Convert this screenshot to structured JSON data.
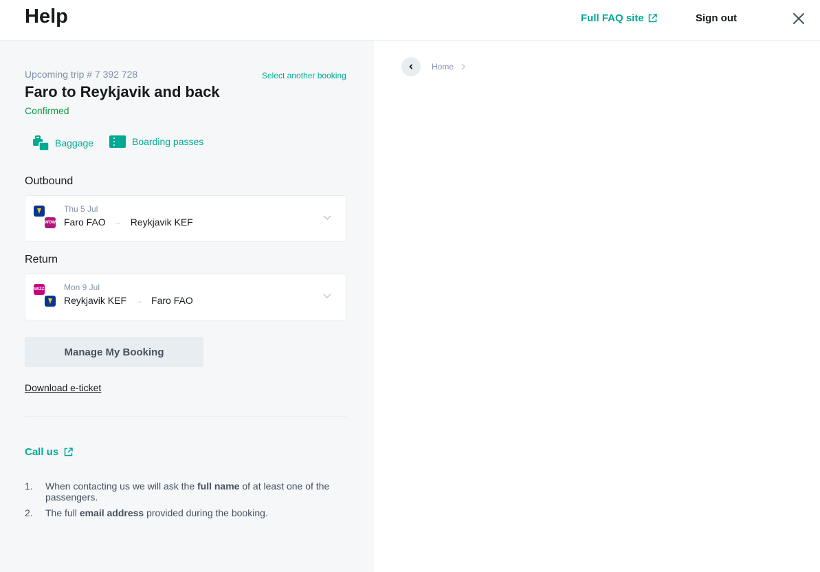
{
  "header": {
    "title": "Help",
    "faq_label": "Full FAQ site",
    "signout_label": "Sign out"
  },
  "booking": {
    "trip_label": "Upcoming trip # 7 392 728",
    "select_another": "Select another booking",
    "title": "Faro to Reykjavik and back",
    "status": "Confirmed",
    "quick_actions": {
      "baggage": "Baggage",
      "boarding": "Boarding passes"
    },
    "outbound": {
      "label": "Outbound",
      "date": "Thu 5 Jul",
      "from": "Faro FAO",
      "to": "Reykjavik KEF",
      "carrier_top": "Ryanair",
      "carrier_bottom": "WOW",
      "carrier_bottom_text": "WOW"
    },
    "return": {
      "label": "Return",
      "date": "Mon 9 Jul",
      "from": "Reykjavik KEF",
      "to": "Faro FAO",
      "carrier_top": "Wizz",
      "carrier_top_text": "WIZZ",
      "carrier_bottom": "Ryanair"
    },
    "manage_label": "Manage My Booking",
    "download_label": "Download e-ticket"
  },
  "contact": {
    "call_us": "Call us",
    "items": [
      {
        "num": "1.",
        "pre": "When contacting us we will ask the ",
        "bold": "full name",
        "post": " of at least one of the passengers."
      },
      {
        "num": "2.",
        "pre": "The full ",
        "bold": "email address",
        "post": " provided during the booking."
      }
    ]
  },
  "breadcrumb": {
    "home": "Home"
  },
  "colors": {
    "accent": "#00a991",
    "confirmed": "#0b9c3a",
    "panel_bg": "#f5f7f9",
    "ryanair": "#073590",
    "wow": "#b0177f",
    "wizz": "#c6007e"
  }
}
